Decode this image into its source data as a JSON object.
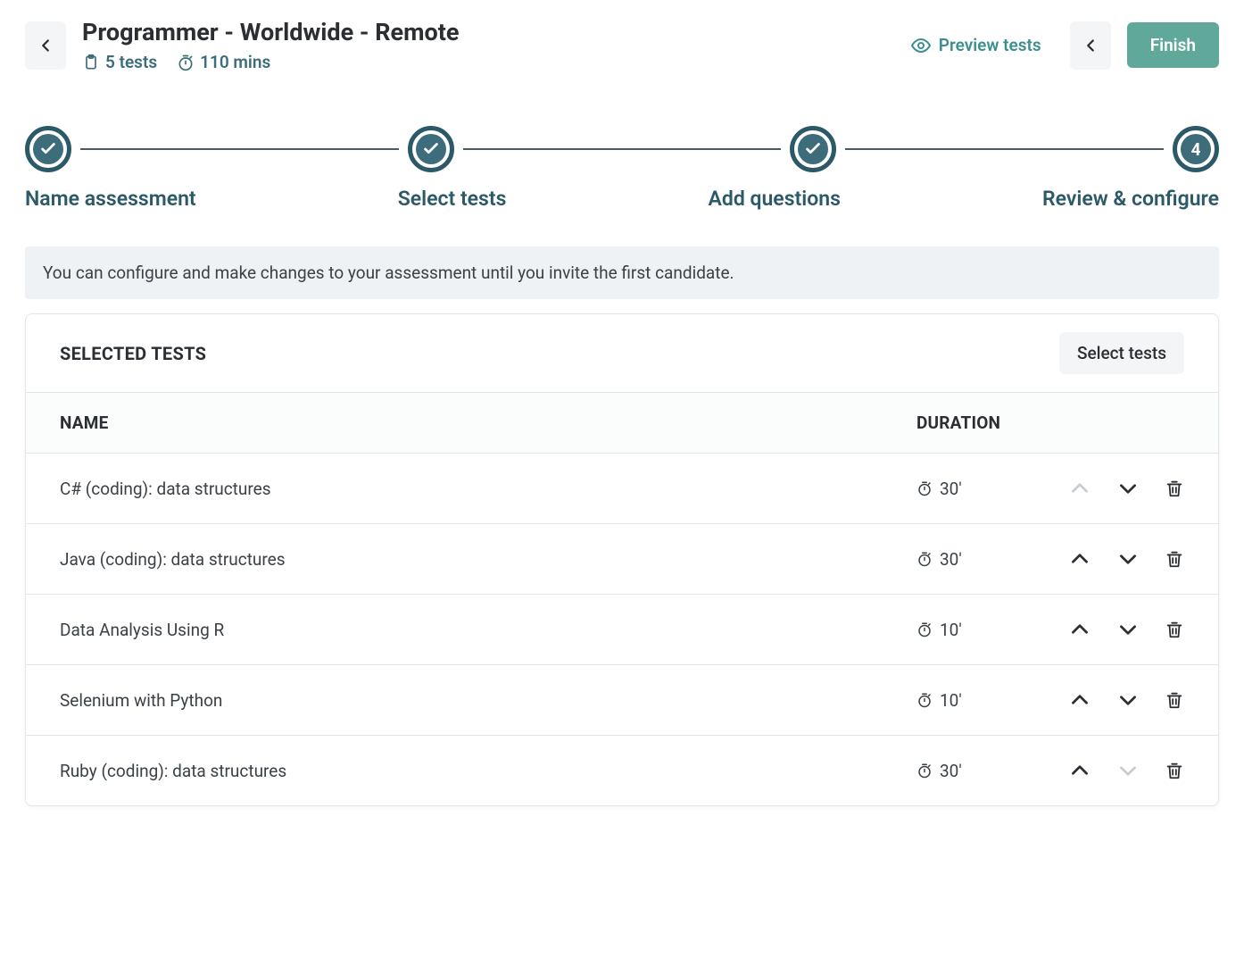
{
  "header": {
    "title": "Programmer - Worldwide - Remote",
    "tests_count": "5 tests",
    "duration": "110 mins",
    "preview": "Preview tests",
    "finish": "Finish"
  },
  "stepper": {
    "steps": [
      {
        "label": "Name assessment",
        "state": "completed"
      },
      {
        "label": "Select tests",
        "state": "completed"
      },
      {
        "label": "Add questions",
        "state": "completed"
      },
      {
        "label": "Review & configure",
        "state": "current",
        "number": "4"
      }
    ]
  },
  "info_banner": "You can configure and make changes to your assessment until you invite the first candidate.",
  "selected_tests": {
    "heading": "SELECTED TESTS",
    "select_button": "Select tests",
    "columns": {
      "name": "NAME",
      "duration": "DURATION"
    },
    "rows": [
      {
        "name": "C# (coding): data structures",
        "duration": "30'",
        "up_disabled": true,
        "down_disabled": false
      },
      {
        "name": "Java (coding): data structures",
        "duration": "30'",
        "up_disabled": false,
        "down_disabled": false
      },
      {
        "name": "Data Analysis Using R",
        "duration": "10'",
        "up_disabled": false,
        "down_disabled": false
      },
      {
        "name": "Selenium with Python",
        "duration": "10'",
        "up_disabled": false,
        "down_disabled": false
      },
      {
        "name": "Ruby (coding): data structures",
        "duration": "30'",
        "up_disabled": false,
        "down_disabled": true
      }
    ]
  }
}
